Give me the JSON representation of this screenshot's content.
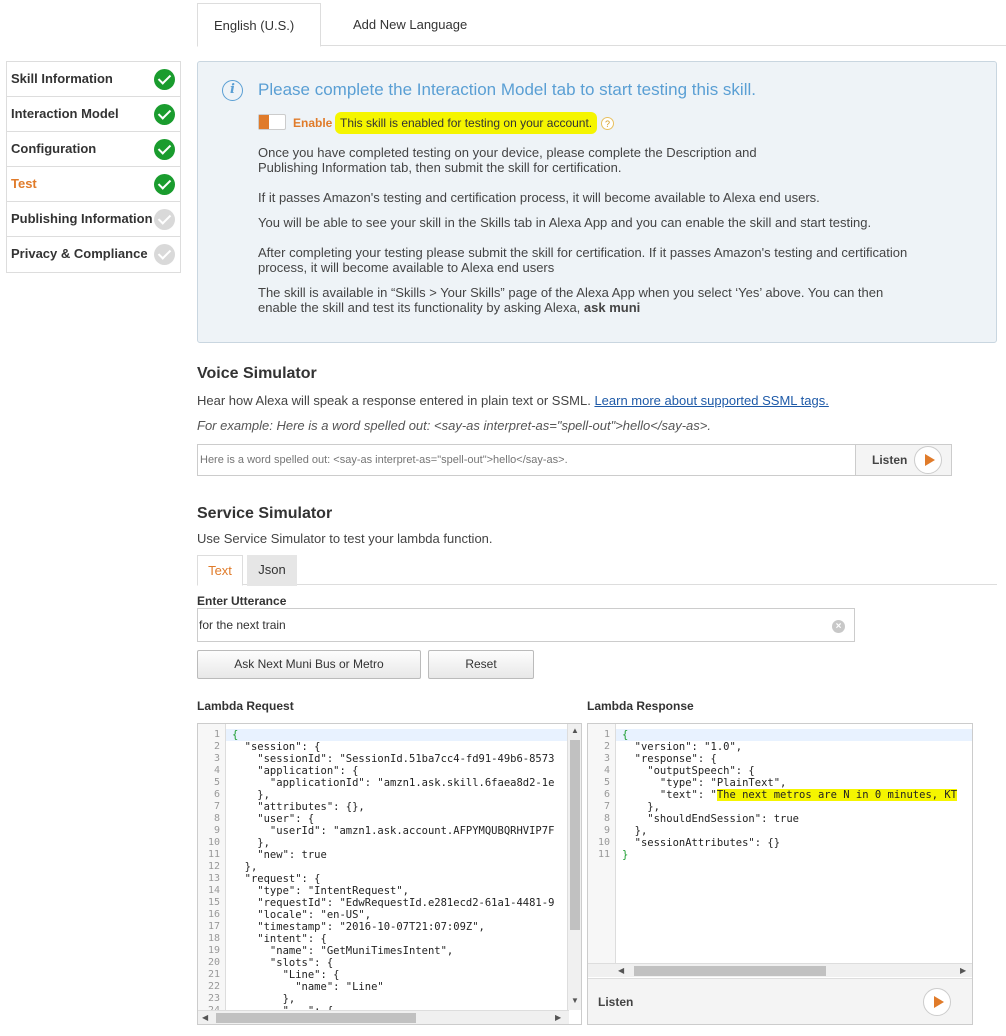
{
  "lang_tabs": {
    "active": "English (U.S.)",
    "add": "Add New Language"
  },
  "nav": [
    {
      "label": "Skill Information",
      "status": "complete"
    },
    {
      "label": "Interaction Model",
      "status": "complete"
    },
    {
      "label": "Configuration",
      "status": "complete"
    },
    {
      "label": "Test",
      "status": "complete",
      "active": true
    },
    {
      "label": "Publishing Information",
      "status": "incomplete"
    },
    {
      "label": "Privacy & Compliance",
      "status": "incomplete"
    }
  ],
  "info": {
    "title": "Please complete the Interaction Model tab to start testing this skill.",
    "enable_label": "Enable",
    "enabled_text": "This skill is enabled for testing on your account.",
    "help": "?",
    "p1a": "Once you have completed testing on your device, please complete the Description and",
    "p1b": "Publishing Information tab, then submit the skill for certification.",
    "p2": "If it passes Amazon's testing and certification process, it will become available to Alexa end users.",
    "p3": "You will be able to see your skill in the Skills tab in Alexa App and you can enable the skill and start testing.",
    "p4a": "After completing your testing please submit the skill for certification. If it passes Amazon's testing and certification",
    "p4b": "process, it will become available to Alexa end users",
    "p5a": "The skill is available in “Skills > Your Skills” page of the Alexa App when you select ‘Yes’ above. You can then",
    "p5b_prefix": "enable the skill and test its functionality by asking Alexa, ",
    "p5b_bold": "ask muni"
  },
  "voice": {
    "title": "Voice Simulator",
    "desc": "Hear how Alexa will speak a response entered in plain text or SSML. ",
    "link": "Learn more about supported SSML tags.",
    "example": "For example: Here is a word spelled out: <say-as interpret-as=\"spell-out\">hello</say-as>.",
    "input_placeholder": "Here is a word spelled out: <say-as interpret-as=\"spell-out\">hello</say-as>.",
    "listen": "Listen"
  },
  "service": {
    "title": "Service Simulator",
    "desc": "Use Service Simulator to test your lambda function.",
    "tab_text": "Text",
    "tab_json": "Json",
    "utterance_label": "Enter Utterance",
    "utterance_value": "for the next train",
    "ask_button": "Ask Next Muni Bus or Metro",
    "reset_button": "Reset",
    "request_label": "Lambda Request",
    "response_label": "Lambda Response",
    "response_listen": "Listen",
    "clear": "×"
  },
  "request_lines": [
    "{",
    "  \"session\": {",
    "    \"sessionId\": \"SessionId.51ba7cc4-fd91-49b6-8573",
    "    \"application\": {",
    "      \"applicationId\": \"amzn1.ask.skill.6faea8d2-1e",
    "    },",
    "    \"attributes\": {},",
    "    \"user\": {",
    "      \"userId\": \"amzn1.ask.account.AFPYMQUBQRHVIP7F",
    "    },",
    "    \"new\": true",
    "  },",
    "  \"request\": {",
    "    \"type\": \"IntentRequest\",",
    "    \"requestId\": \"EdwRequestId.e281ecd2-61a1-4481-9",
    "    \"locale\": \"en-US\",",
    "    \"timestamp\": \"2016-10-07T21:07:09Z\",",
    "    \"intent\": {",
    "      \"name\": \"GetMuniTimesIntent\",",
    "      \"slots\": {",
    "        \"Line\": {",
    "          \"name\": \"Line\"",
    "        },",
    "        \"...\": {",
    "          ..."
  ],
  "response_lines": [
    "{",
    "  \"version\": \"1.0\",",
    "  \"response\": {",
    "    \"outputSpeech\": {",
    "      \"type\": \"PlainText\",",
    "      \"text\": \"The next metros are N in 0 minutes, KT",
    "    },",
    "    \"shouldEndSession\": true",
    "  },",
    "  \"sessionAttributes\": {}",
    "}"
  ]
}
